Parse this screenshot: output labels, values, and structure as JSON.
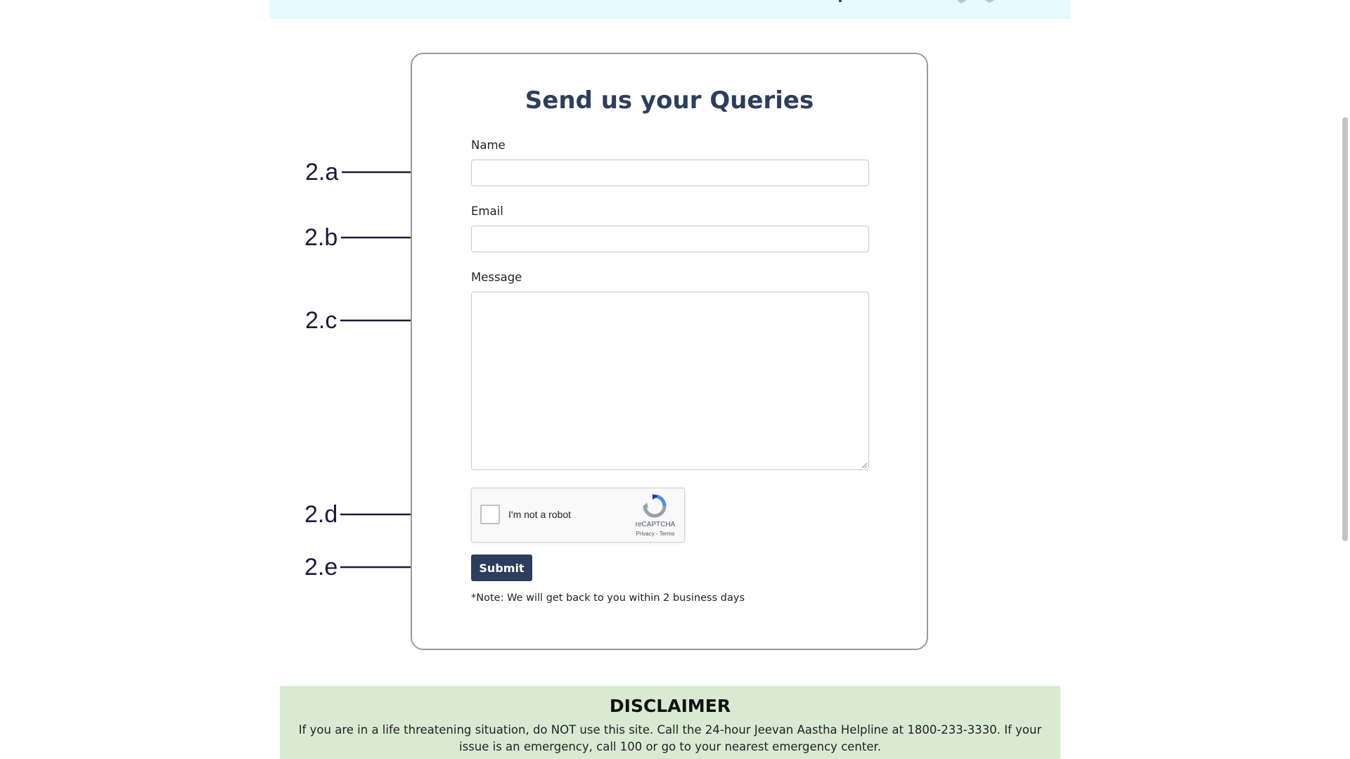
{
  "form": {
    "title": "Send us your Queries",
    "name_label": "Name",
    "name_value": "",
    "email_label": "Email",
    "email_value": "",
    "message_label": "Message",
    "message_value": "",
    "recaptcha": {
      "label": "I'm not a robot",
      "brand": "reCAPTCHA",
      "privacy_link": "Privacy",
      "separator": "-",
      "terms_link": "Terms"
    },
    "submit_label": "Submit",
    "note": "*Note: We will get back to you within 2 business days"
  },
  "annotations": {
    "a": "2.a",
    "b": "2.b",
    "c": "2.c",
    "d": "2.d",
    "e": "2.e"
  },
  "disclaimer": {
    "title": "DISCLAIMER",
    "text": "If you are in a life threatening situation, do NOT use this site. Call the 24-hour Jeevan Aastha Helpline at 1800-233-3330. If your issue is an emergency, call 100 or go to your nearest emergency center."
  },
  "colors": {
    "brand_navy": "#2c3e5c",
    "top_banner_bg": "#e6fbfd",
    "disclaimer_bg": "#d9ead3",
    "annotation_arrow": "#1a1a3a"
  }
}
